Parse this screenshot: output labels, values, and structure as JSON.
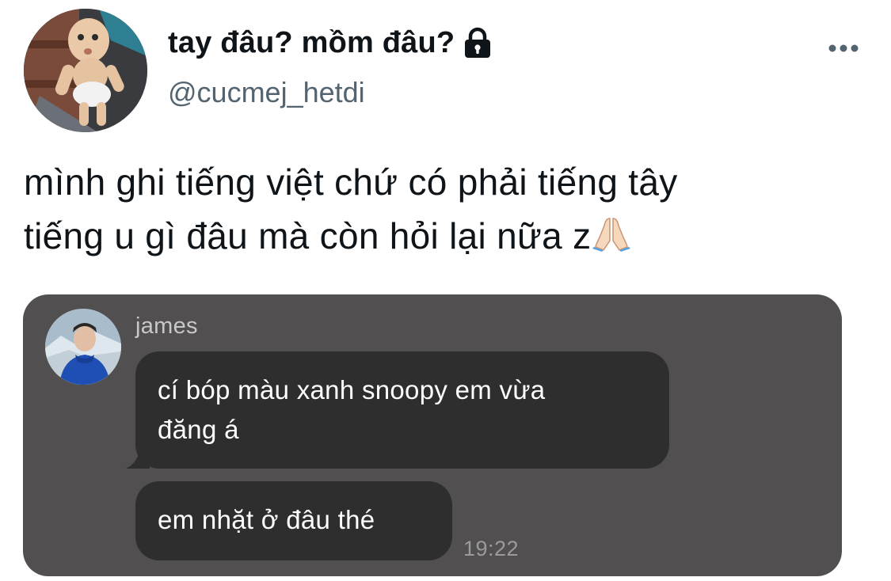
{
  "tweet": {
    "display_name": "tay đâu? mồm đâu?",
    "handle": "@cucmej_hetdi",
    "text_line_1": "mình ghi tiếng việt chứ có phải tiếng tây",
    "text_line_2": "tiếng u gì đâu mà còn hỏi lại nữa z",
    "icons": {
      "lock": "lock-icon",
      "more": "more-options-icon",
      "emoji": "folded-hands-emoji"
    },
    "colors": {
      "text": "#0f1419",
      "handle": "#536471"
    }
  },
  "attachment": {
    "sender_name": "james",
    "messages": [
      {
        "line_1": "cí bóp màu xanh snoopy em vừa",
        "line_2": "đăng á"
      },
      {
        "text": "em nhặt ở đâu thé"
      }
    ],
    "time": "19:22",
    "colors": {
      "background": "#514f50",
      "bubble": "#2f2e2f",
      "sender": "#c9c8c9",
      "time": "#9c9b9c"
    }
  }
}
